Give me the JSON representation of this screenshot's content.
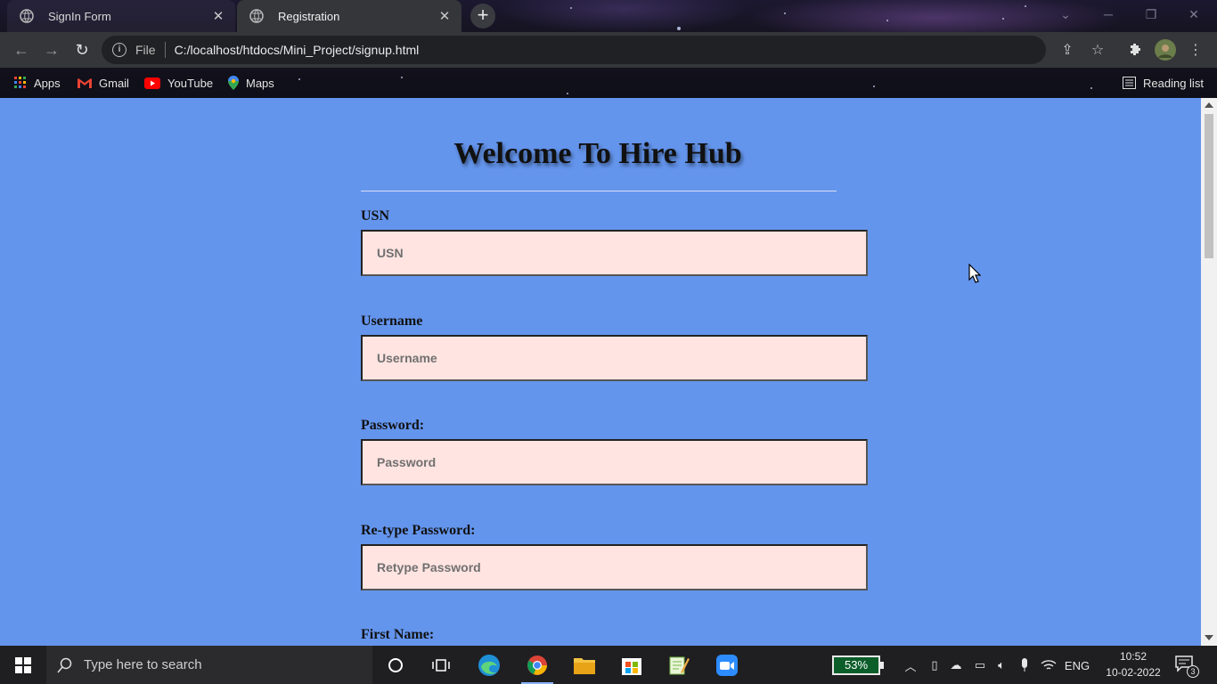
{
  "browser": {
    "tabs": [
      {
        "label": "SignIn Form",
        "active": false
      },
      {
        "label": "Registration",
        "active": true
      }
    ],
    "new_tab_label": "+",
    "address": {
      "scheme_label": "File",
      "url": "C:/localhost/htdocs/Mini_Project/signup.html"
    },
    "bookmarks": [
      {
        "label": "Apps",
        "icon": "apps-grid-icon"
      },
      {
        "label": "Gmail",
        "icon": "gmail-icon"
      },
      {
        "label": "YouTube",
        "icon": "youtube-icon"
      },
      {
        "label": "Maps",
        "icon": "maps-icon"
      }
    ],
    "reading_list_label": "Reading list"
  },
  "page": {
    "background": "#6495ed",
    "title": "Welcome To Hire Hub",
    "fields": [
      {
        "label": "USN",
        "placeholder": "USN",
        "value": ""
      },
      {
        "label": "Username",
        "placeholder": "Username",
        "value": ""
      },
      {
        "label": "Password:",
        "placeholder": "Password",
        "value": ""
      },
      {
        "label": "Re-type Password:",
        "placeholder": "Retype Password",
        "value": ""
      },
      {
        "label": "First Name:"
      }
    ],
    "input_background": "#ffe4e1"
  },
  "taskbar": {
    "search_placeholder": "Type here to search",
    "battery_percent": "53%",
    "language": "ENG",
    "time": "10:52",
    "date": "10-02-2022",
    "notification_count": "3"
  }
}
